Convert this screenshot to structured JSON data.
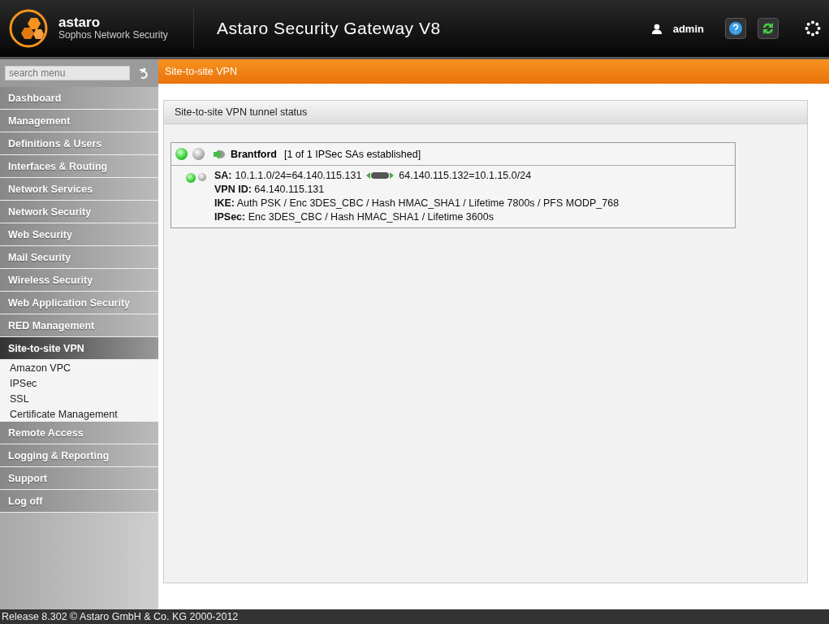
{
  "header": {
    "brand": "astaro",
    "tagline": "Sophos Network Security",
    "title": "Astaro Security Gateway V8",
    "user": "admin"
  },
  "sidebar": {
    "search": {
      "placeholder": "search menu"
    },
    "items": [
      {
        "label": "Dashboard",
        "selected": false
      },
      {
        "label": "Management",
        "selected": false
      },
      {
        "label": "Definitions & Users",
        "selected": false
      },
      {
        "label": "Interfaces & Routing",
        "selected": false
      },
      {
        "label": "Network Services",
        "selected": false
      },
      {
        "label": "Network Security",
        "selected": false
      },
      {
        "label": "Web Security",
        "selected": false
      },
      {
        "label": "Mail Security",
        "selected": false
      },
      {
        "label": "Wireless Security",
        "selected": false
      },
      {
        "label": "Web Application Security",
        "selected": false
      },
      {
        "label": "RED Management",
        "selected": false
      },
      {
        "label": "Site-to-site VPN",
        "selected": true,
        "expanded": true,
        "children": [
          {
            "label": "Amazon VPC"
          },
          {
            "label": "IPSec"
          },
          {
            "label": "SSL"
          },
          {
            "label": "Certificate Management"
          }
        ]
      },
      {
        "label": "Remote Access",
        "selected": false
      },
      {
        "label": "Logging & Reporting",
        "selected": false
      },
      {
        "label": "Support",
        "selected": false
      },
      {
        "label": "Log off",
        "selected": false
      }
    ]
  },
  "breadcrumb": "Site-to-site VPN",
  "panel": {
    "title": "Site-to-site VPN tunnel status",
    "tunnels": [
      {
        "name": "Brantford",
        "summary": "[1 of 1 IPSec SAs established]",
        "up": true,
        "sas": [
          {
            "up": true,
            "local": "10.1.1.0/24=64.140.115.131",
            "remote": "64.140.115.132=10.1.15.0/24",
            "lines": [
              "**VPN ID:** 64.140.115.131",
              "**IKE:** Auth PSK / Enc 3DES_CBC / Hash HMAC_SHA1 / Lifetime 7800s / PFS MODP_768",
              "**IPSec:** Enc 3DES_CBC / Hash HMAC_SHA1 / Lifetime 3600s"
            ],
            "sa_label": "SA:"
          }
        ]
      }
    ]
  },
  "footer": "Release 8.302  © Astaro GmbH & Co. KG 2000-2012"
}
